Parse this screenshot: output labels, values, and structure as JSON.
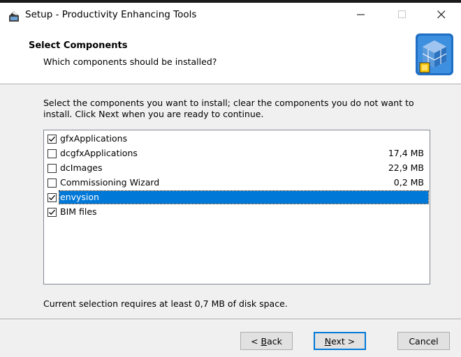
{
  "window": {
    "title": "Setup - Productivity Enhancing Tools",
    "minimize_glyph": "—",
    "maximize_glyph": "☐",
    "close_glyph": "✕"
  },
  "header": {
    "title": "Select Components",
    "subtitle": "Which components should be installed?"
  },
  "body": {
    "description": "Select the components you want to install; clear the components you do not want to install. Click Next when you are ready to continue.",
    "components": [
      {
        "label": "gfxApplications",
        "size": "",
        "checked": true,
        "selected": false
      },
      {
        "label": "dcgfxApplications",
        "size": "17,4 MB",
        "checked": false,
        "selected": false
      },
      {
        "label": "dcImages",
        "size": "22,9 MB",
        "checked": false,
        "selected": false
      },
      {
        "label": "Commissioning Wizard",
        "size": "0,2 MB",
        "checked": false,
        "selected": false
      },
      {
        "label": "envysion",
        "size": "",
        "checked": true,
        "selected": true
      },
      {
        "label": "BIM files",
        "size": "",
        "checked": true,
        "selected": false
      }
    ],
    "requirement": "Current selection requires at least 0,7 MB of disk space."
  },
  "footer": {
    "back_label_pre": "< ",
    "back_label_key": "B",
    "back_label_post": "ack",
    "next_label_key": "N",
    "next_label_post": "ext >",
    "cancel_label": "Cancel"
  },
  "colors": {
    "selection": "#0078d7",
    "dialog_bg": "#f0f0f0"
  },
  "icons": {
    "app": "setup-wizard-icon",
    "header": "components-cube-icon"
  }
}
